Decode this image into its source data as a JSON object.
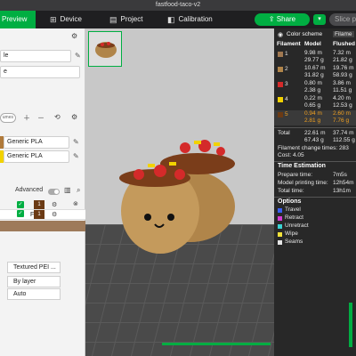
{
  "window": {
    "title": "fastfood-taco-v2"
  },
  "toolbar": {
    "preview_label": "Preview",
    "device_label": "Device",
    "project_label": "Project",
    "calibration_label": "Calibration",
    "share_label": "Share",
    "slice_label": "Slice pl"
  },
  "sidebar": {
    "field1": "le",
    "field2": "e",
    "volumes_chip": "umes",
    "filament1": "Generic PLA",
    "filament2": "Generic PLA",
    "advanced_label": "Advanced",
    "fila_header": "Fila.",
    "row1_num": "1",
    "row2_num": "1",
    "plate_type": "Textured PEI ...",
    "by_layer": "By layer",
    "auto": "Auto",
    "colors": {
      "filament1": "#b07a3a",
      "filament2": "#f2d200"
    }
  },
  "panel": {
    "color_scheme_label": "Color scheme",
    "filament_dd": "Filame",
    "col_filament": "Filament",
    "col_model": "Model",
    "col_flushed": "Flushed",
    "rows": [
      {
        "id": "1",
        "model_m": "9.98 m",
        "model_g": "29.77 g",
        "flush_m": "7.32 m",
        "flush_g": "21.82 g",
        "color": "#a07850"
      },
      {
        "id": "2",
        "model_m": "10.67 m",
        "model_g": "31.82 g",
        "flush_m": "19.76 m",
        "flush_g": "58.93 g",
        "color": "#b0854a"
      },
      {
        "id": "3",
        "model_m": "0.80 m",
        "model_g": "2.38 g",
        "flush_m": "3.86 m",
        "flush_g": "11.51 g",
        "color": "#d42a2a"
      },
      {
        "id": "4",
        "model_m": "0.22 m",
        "model_g": "0.65 g",
        "flush_m": "4.20 m",
        "flush_g": "12.53 g",
        "color": "#f2d200"
      },
      {
        "id": "5",
        "model_m": "0.94 m",
        "model_g": "2.81 g",
        "flush_m": "2.60 m",
        "flush_g": "7.76 g",
        "color": "#6b3a14"
      }
    ],
    "total_label": "Total",
    "total_model_m": "22.61 m",
    "total_model_g": "67.43 g",
    "total_flush_m": "37.74 m",
    "total_flush_g": "112.55 g",
    "change_times": "Filament change times: 283",
    "cost": "Cost: 4.05",
    "time_estimation_label": "Time Estimation",
    "prepare_label": "Prepare time:",
    "prepare_value": "7m5s",
    "model_time_label": "Model printing time:",
    "model_time_value": "12h54m",
    "total_time_label": "Total time:",
    "total_time_value": "13h1m",
    "options_label": "Options",
    "options": [
      {
        "label": "Travel",
        "color": "#3a5ff2"
      },
      {
        "label": "Retract",
        "color": "#d43ad4"
      },
      {
        "label": "Unretract",
        "color": "#3ad4d4"
      },
      {
        "label": "Wipe",
        "color": "#f2e23a"
      },
      {
        "label": "Seams",
        "color": "#e6e6e6"
      }
    ]
  }
}
